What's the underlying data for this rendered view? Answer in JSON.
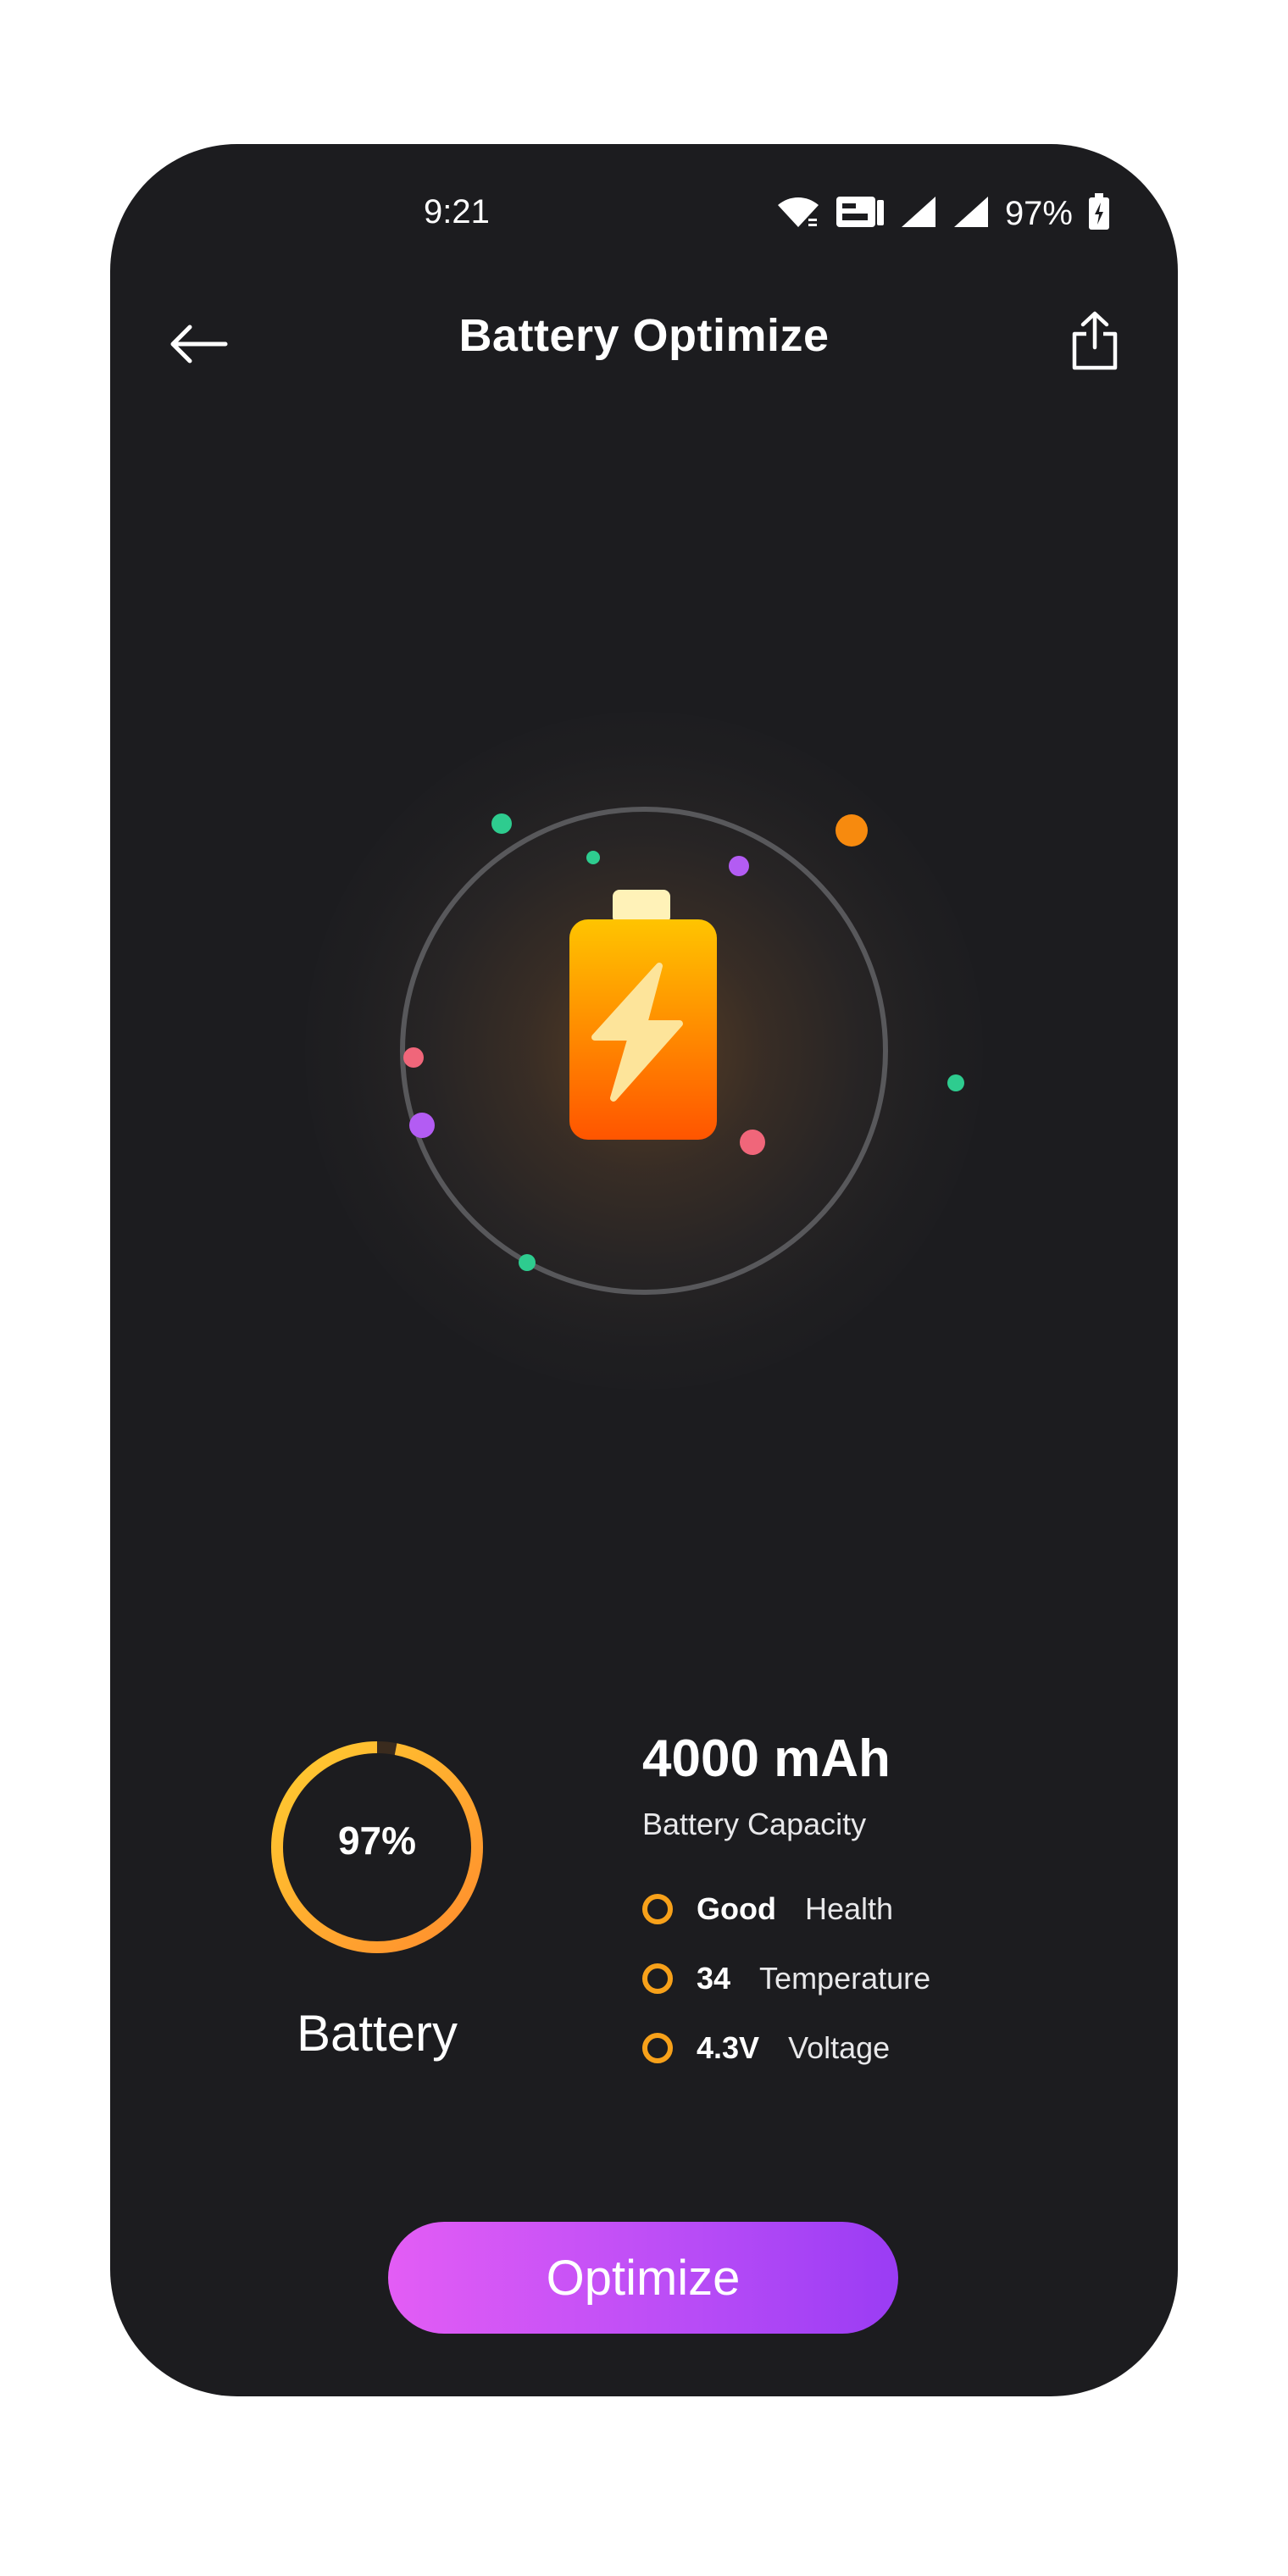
{
  "status_bar": {
    "time": "9:21",
    "battery_percent": "97%",
    "icons": [
      "wifi-icon",
      "volte-icon",
      "signal-icon",
      "signal-icon",
      "battery-charging-icon"
    ]
  },
  "header": {
    "title": "Battery Optimize",
    "back_icon": "arrow-left-icon",
    "share_icon": "share-icon"
  },
  "hero": {
    "icon": "battery-charging-icon",
    "particle_colors": [
      "#2ecc8f",
      "#f78a0e",
      "#b35cf3",
      "#f0667a"
    ]
  },
  "battery": {
    "percent_text": "97%",
    "level": 0.97,
    "label": "Battery"
  },
  "capacity": {
    "value": "4000 mAh",
    "label": "Battery Capacity"
  },
  "metrics": [
    {
      "value": "Good",
      "name": "Health"
    },
    {
      "value": "34",
      "name": "Temperature"
    },
    {
      "value": "4.3V",
      "name": "Voltage"
    }
  ],
  "actions": {
    "optimize_label": "Optimize"
  },
  "colors": {
    "background": "#1c1c1f",
    "accent_orange": "#f7a11a",
    "button_gradient_start": "#e35df5",
    "button_gradient_end": "#9a3cf4"
  }
}
